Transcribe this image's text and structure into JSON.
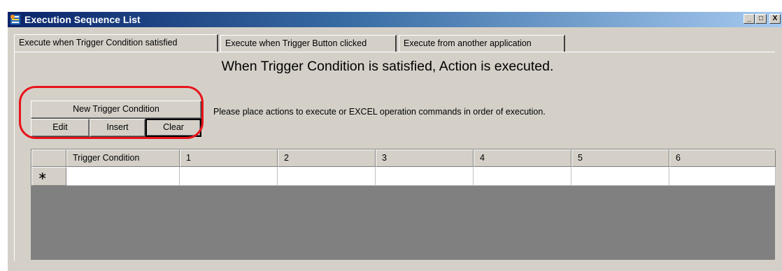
{
  "window": {
    "title": "Execution Sequence List",
    "controls": [
      "_",
      "□",
      "X"
    ]
  },
  "tabs": [
    {
      "label": "Execute when Trigger Condition satisfied",
      "active": true
    },
    {
      "label": "Execute when Trigger Button clicked",
      "active": false
    },
    {
      "label": "Execute from another application",
      "active": false
    }
  ],
  "panel": {
    "heading": "When Trigger Condition is satisfied, Action is executed.",
    "instruction": "Please place actions to execute or EXCEL operation commands in order of execution.",
    "buttons": {
      "new_trigger": "New Trigger Condition",
      "edit": "Edit",
      "insert": "Insert",
      "clear": "Clear"
    }
  },
  "grid": {
    "columns": [
      "",
      "Trigger Condition",
      "1",
      "2",
      "3",
      "4",
      "5",
      "6"
    ],
    "new_row_marker": "∗"
  },
  "colors": {
    "callout": "#e8141b",
    "titlebar_start": "#0a246a",
    "titlebar_end": "#a6caf0",
    "face": "#d4d0c8"
  },
  "icons": [
    "app-icon",
    "minimize-icon",
    "maximize-icon",
    "close-icon"
  ]
}
